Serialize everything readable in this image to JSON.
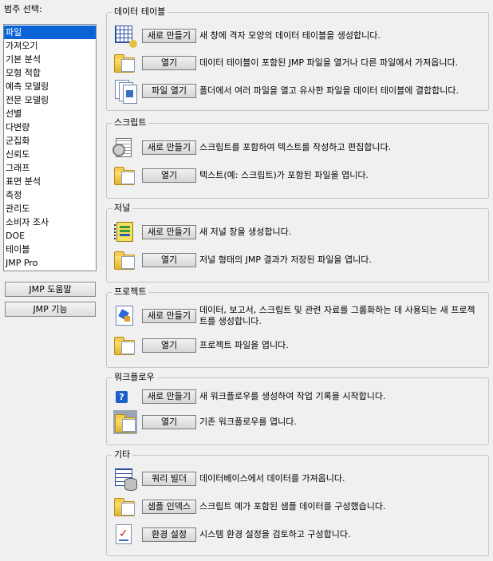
{
  "categories": {
    "label": "범주 선택:",
    "items": [
      "파일",
      "가져오기",
      "기본 분석",
      "모형 적합",
      "예측 모델링",
      "전문 모델링",
      "선별",
      "다변량",
      "군집화",
      "신뢰도",
      "그래프",
      "표면 분석",
      "측정",
      "관리도",
      "소비자 조사",
      "DOE",
      "테이블",
      "JMP Pro"
    ],
    "selected": "파일"
  },
  "side_buttons": {
    "help": "JMP 도움말",
    "features": "JMP 기능"
  },
  "colors": {
    "selection": "#0a64d7",
    "background": "#f0f0f0"
  },
  "groups": {
    "data_table": {
      "title": "데이터 테이블",
      "new_label": "새로 만들기",
      "new_desc": "새 창에 격자 모양의 데이터 테이블을 생성합니다.",
      "new_icon": "data-table-icon",
      "open_label": "열기",
      "open_desc": "데이터 테이블이 포함된 JMP 파일을 열거나 다른 파일에서 가져옵니다.",
      "open_icon": "open-folder-icon",
      "open_files_label": "파일 열기",
      "open_files_desc": "폴더에서 여러 파일을 열고 유사한 파일을 데이터 테이블에 결합합니다.",
      "open_files_icon": "multiple-files-icon"
    },
    "script": {
      "title": "스크립트",
      "new_label": "새로 만들기",
      "new_desc": "스크립트를 포함하여 텍스트를 작성하고 편집합니다.",
      "new_icon": "script-icon",
      "open_label": "열기",
      "open_desc": "텍스트(예: 스크립트)가 포함된 파일을 엽니다.",
      "open_icon": "open-folder-icon"
    },
    "journal": {
      "title": "저널",
      "new_label": "새로 만들기",
      "new_desc": "새 저널 창을 생성합니다.",
      "new_icon": "journal-icon",
      "open_label": "열기",
      "open_desc": "저널 형태의 JMP 결과가 저장된 파일을 엽니다.",
      "open_icon": "open-folder-icon"
    },
    "project": {
      "title": "프로젝트",
      "new_label": "새로 만들기",
      "new_desc": "데이터, 보고서, 스크립트 및 관련 자료를 그룹화하는 데 사용되는 새 프로젝트를 생성합니다.",
      "new_icon": "project-icon",
      "open_label": "열기",
      "open_desc": "프로젝트 파일을 엽니다.",
      "open_icon": "open-folder-icon"
    },
    "workflow": {
      "title": "워크플로우",
      "new_label": "새로 만들기",
      "new_desc": "새 워크플로우를 생성하여 작업 기록을 시작합니다.",
      "new_icon": "help-question-icon",
      "open_label": "열기",
      "open_desc": "기존 워크플로우를 엽니다.",
      "open_icon": "workflow-folder-icon"
    },
    "other": {
      "title": "기타",
      "query_label": "쿼리 빌더",
      "query_desc": "데이터베이스에서 데이터를 가져옵니다.",
      "query_icon": "database-query-icon",
      "sample_label": "샘플 인덱스",
      "sample_desc": "스크립트 예가 포함된 샘플 데이터를 구성했습니다.",
      "sample_icon": "open-folder-icon",
      "prefs_label": "환경 설정",
      "prefs_desc": "시스템 환경 설정을 검토하고 구성합니다.",
      "prefs_icon": "preferences-checklist-icon"
    }
  }
}
